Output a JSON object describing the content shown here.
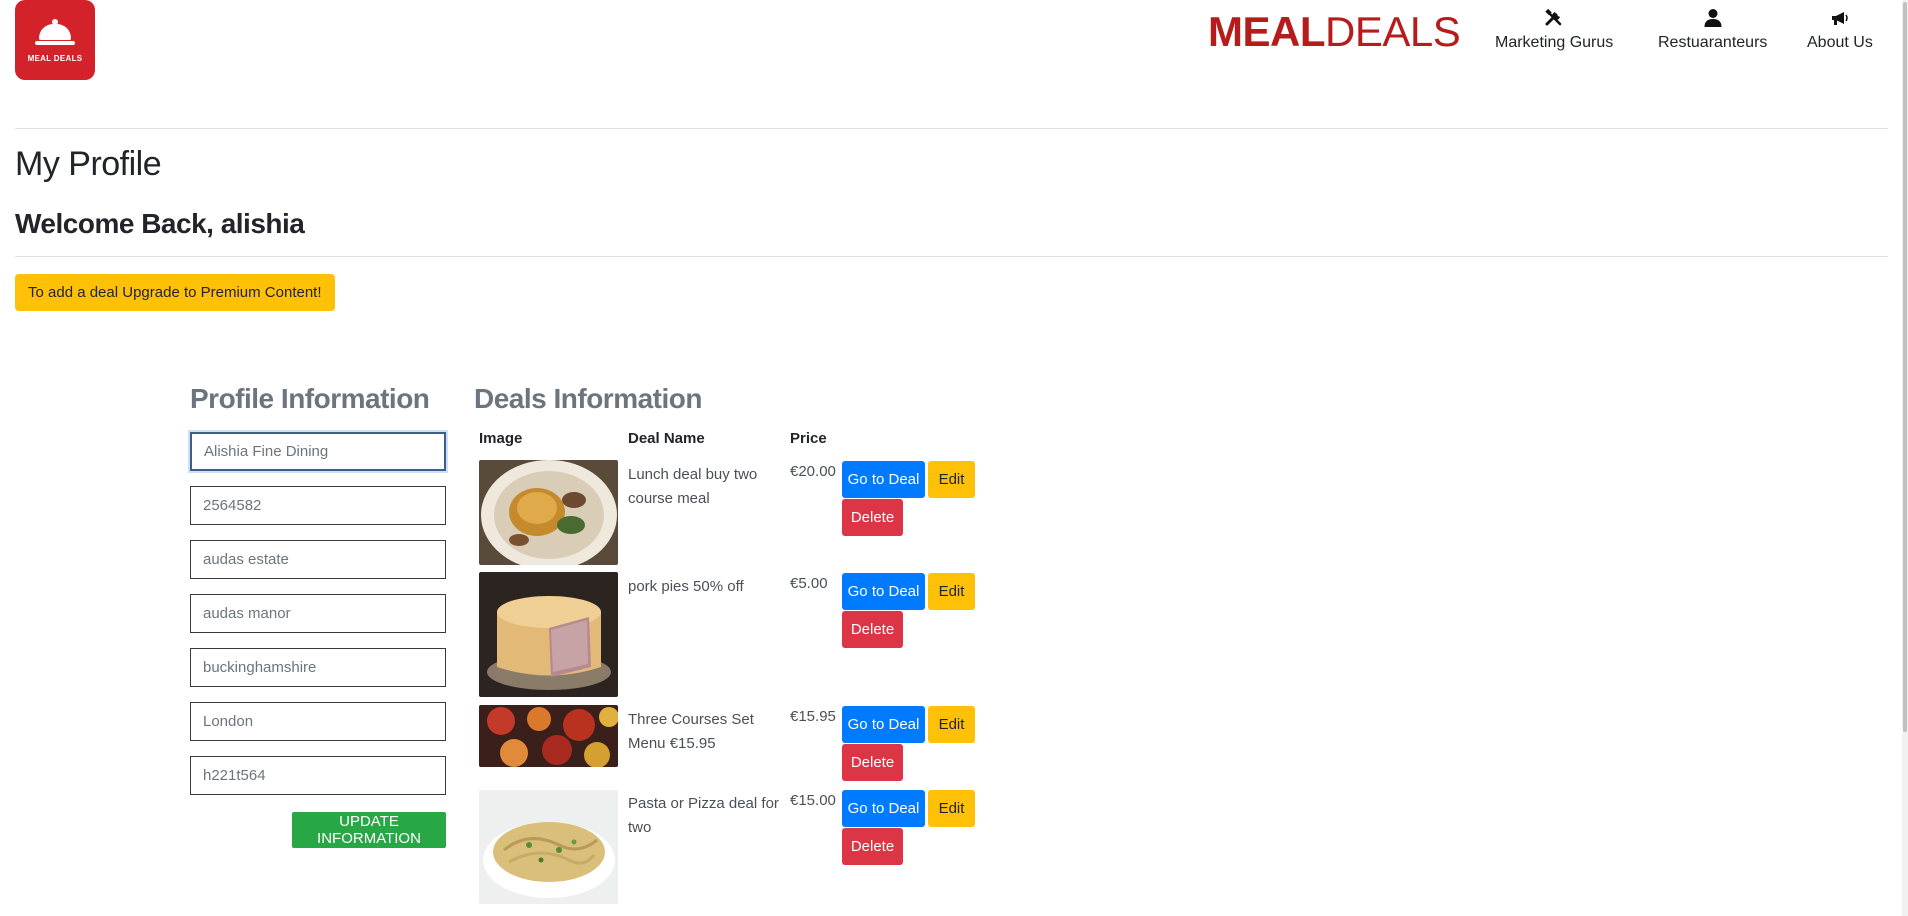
{
  "header": {
    "logo_text": "MEAL DEALS",
    "brand_bold": "MEAL",
    "brand_rest": "DEALS",
    "nav": [
      {
        "label": "Marketing Gurus",
        "icon": "tools-icon"
      },
      {
        "label": "Restuaranteurs",
        "icon": "user-icon"
      },
      {
        "label": "About Us",
        "icon": "megaphone-icon"
      }
    ]
  },
  "page": {
    "title": "My Profile",
    "welcome": "Welcome Back, alishia",
    "premium_button": "To add a deal Upgrade to Premium Content!"
  },
  "profile": {
    "title": "Profile Information",
    "fields": [
      {
        "value": "Alishia Fine Dining"
      },
      {
        "value": "2564582"
      },
      {
        "value": "audas estate"
      },
      {
        "value": "audas manor"
      },
      {
        "value": "buckinghamshire"
      },
      {
        "value": "London"
      },
      {
        "value": "h221t564"
      }
    ],
    "update_button": "UPDATE INFORMATION"
  },
  "deals": {
    "title": "Deals Information",
    "columns": {
      "image": "Image",
      "name": "Deal Name",
      "price": "Price"
    },
    "go_label": "Go to Deal",
    "edit_label": "Edit",
    "delete_label": "Delete",
    "rows": [
      {
        "name": "Lunch deal buy two course meal",
        "price": "€20.00",
        "image": "pie-dish-image"
      },
      {
        "name": "pork pies 50% off",
        "price": "€5.00",
        "image": "pork-pie-image"
      },
      {
        "name": "Three Courses Set Menu €15.95",
        "price": "€15.95",
        "image": "set-menu-image"
      },
      {
        "name": "Pasta or Pizza deal for two",
        "price": "€15.00",
        "image": "pasta-image"
      }
    ]
  },
  "colors": {
    "brand_red": "#b71c1c",
    "logo_red": "#d32229",
    "primary_blue": "#007bff",
    "warning_yellow": "#ffc107",
    "danger_red": "#dc3545",
    "success_green": "#28a745"
  }
}
